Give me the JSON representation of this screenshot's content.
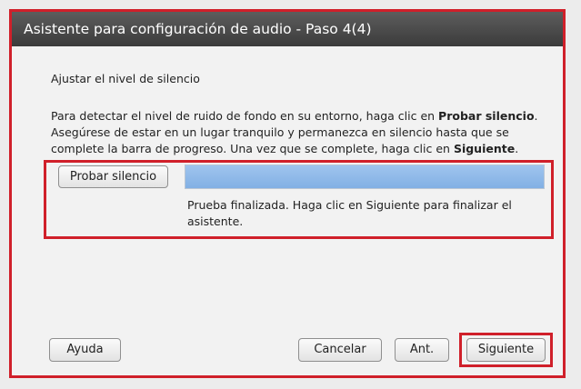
{
  "window": {
    "title": "Asistente para configuración de audio - Paso 4(4)"
  },
  "content": {
    "section_title": "Ajustar el nivel de silencio",
    "instructions": {
      "part1": "Para detectar el nivel de ruido de fondo en su entorno, haga clic en ",
      "bold1": "Probar silencio",
      "part2": ". Asegúrese de estar en un lugar tranquilo y permanezca en silencio hasta que se complete la barra de progreso. Una vez que se complete, haga clic en ",
      "bold2": "Siguiente",
      "part3": "."
    },
    "test_button_label": "Probar silencio",
    "progress_percent": 100,
    "status_text": "Prueba finalizada. Haga clic en Siguiente para finalizar el asistente."
  },
  "footer": {
    "help_label": "Ayuda",
    "cancel_label": "Cancelar",
    "back_label": "Ant.",
    "next_label": "Siguiente"
  },
  "colors": {
    "highlight": "#d0202a",
    "progress_fill": "#8ab8ea",
    "titlebar": "#4a4a4a"
  }
}
